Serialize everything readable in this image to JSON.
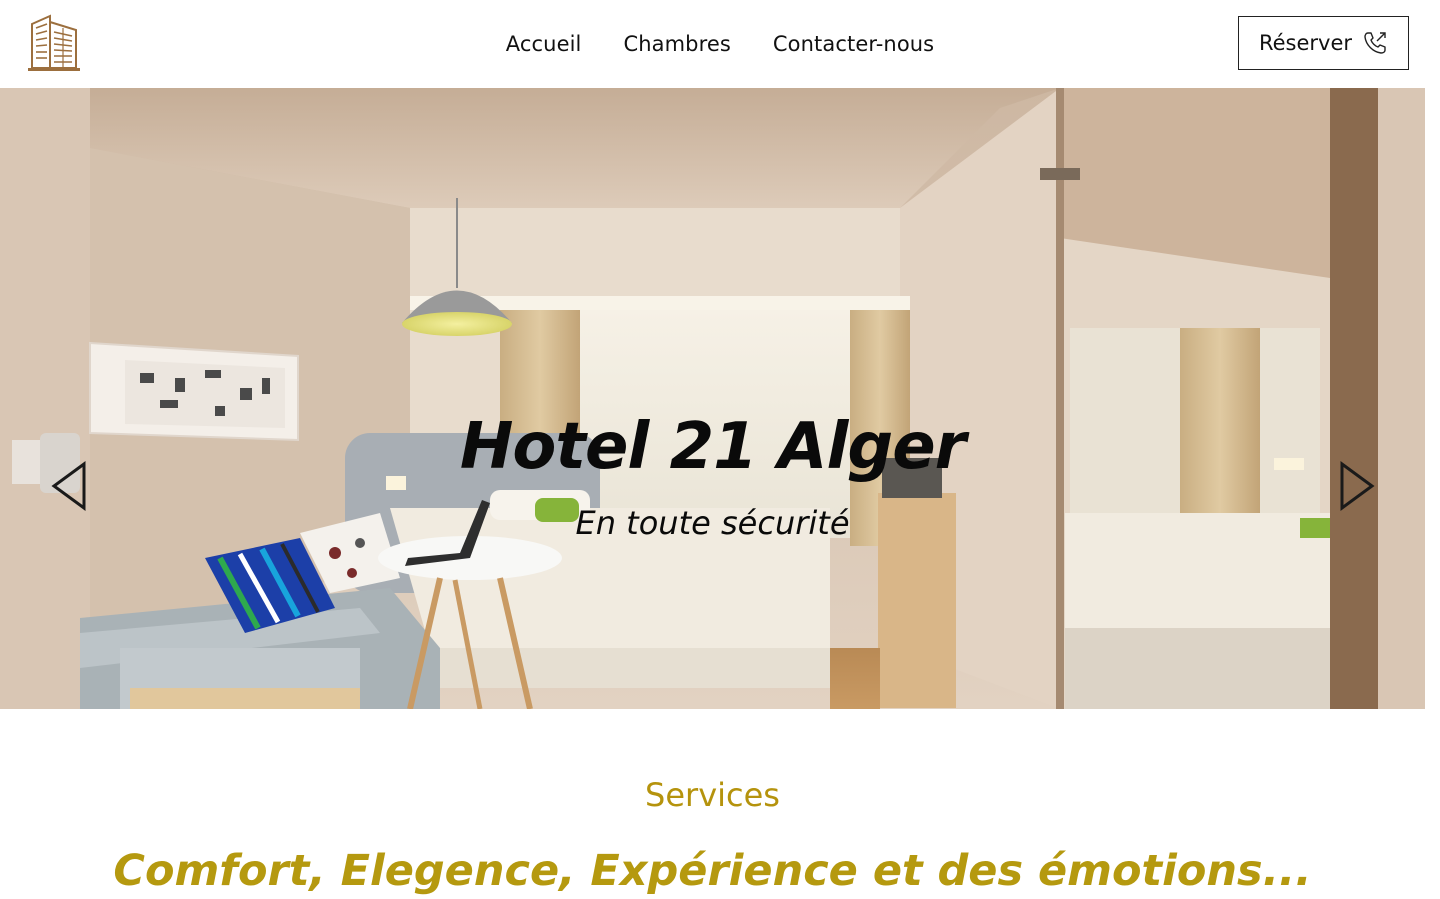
{
  "header": {
    "logo_icon": "hotel-building-icon",
    "nav": [
      {
        "label": "Accueil"
      },
      {
        "label": "Chambres"
      },
      {
        "label": "Contacter-nous"
      }
    ],
    "reserve_button": {
      "label": "Réserver",
      "icon": "phone-outgoing-icon"
    }
  },
  "hero": {
    "title": "Hotel 21 Alger",
    "subtitle": "En toute sécurité",
    "prev_icon": "triangle-left-icon",
    "next_icon": "triangle-right-icon",
    "image": "hotel-room-photo"
  },
  "services": {
    "label": "Services",
    "headline": "Comfort, Elegence, Expérience et des émotions..."
  },
  "colors": {
    "accent_gold": "#b5930d",
    "logo_brown": "#9c6f3e",
    "text_dark": "#111111"
  }
}
